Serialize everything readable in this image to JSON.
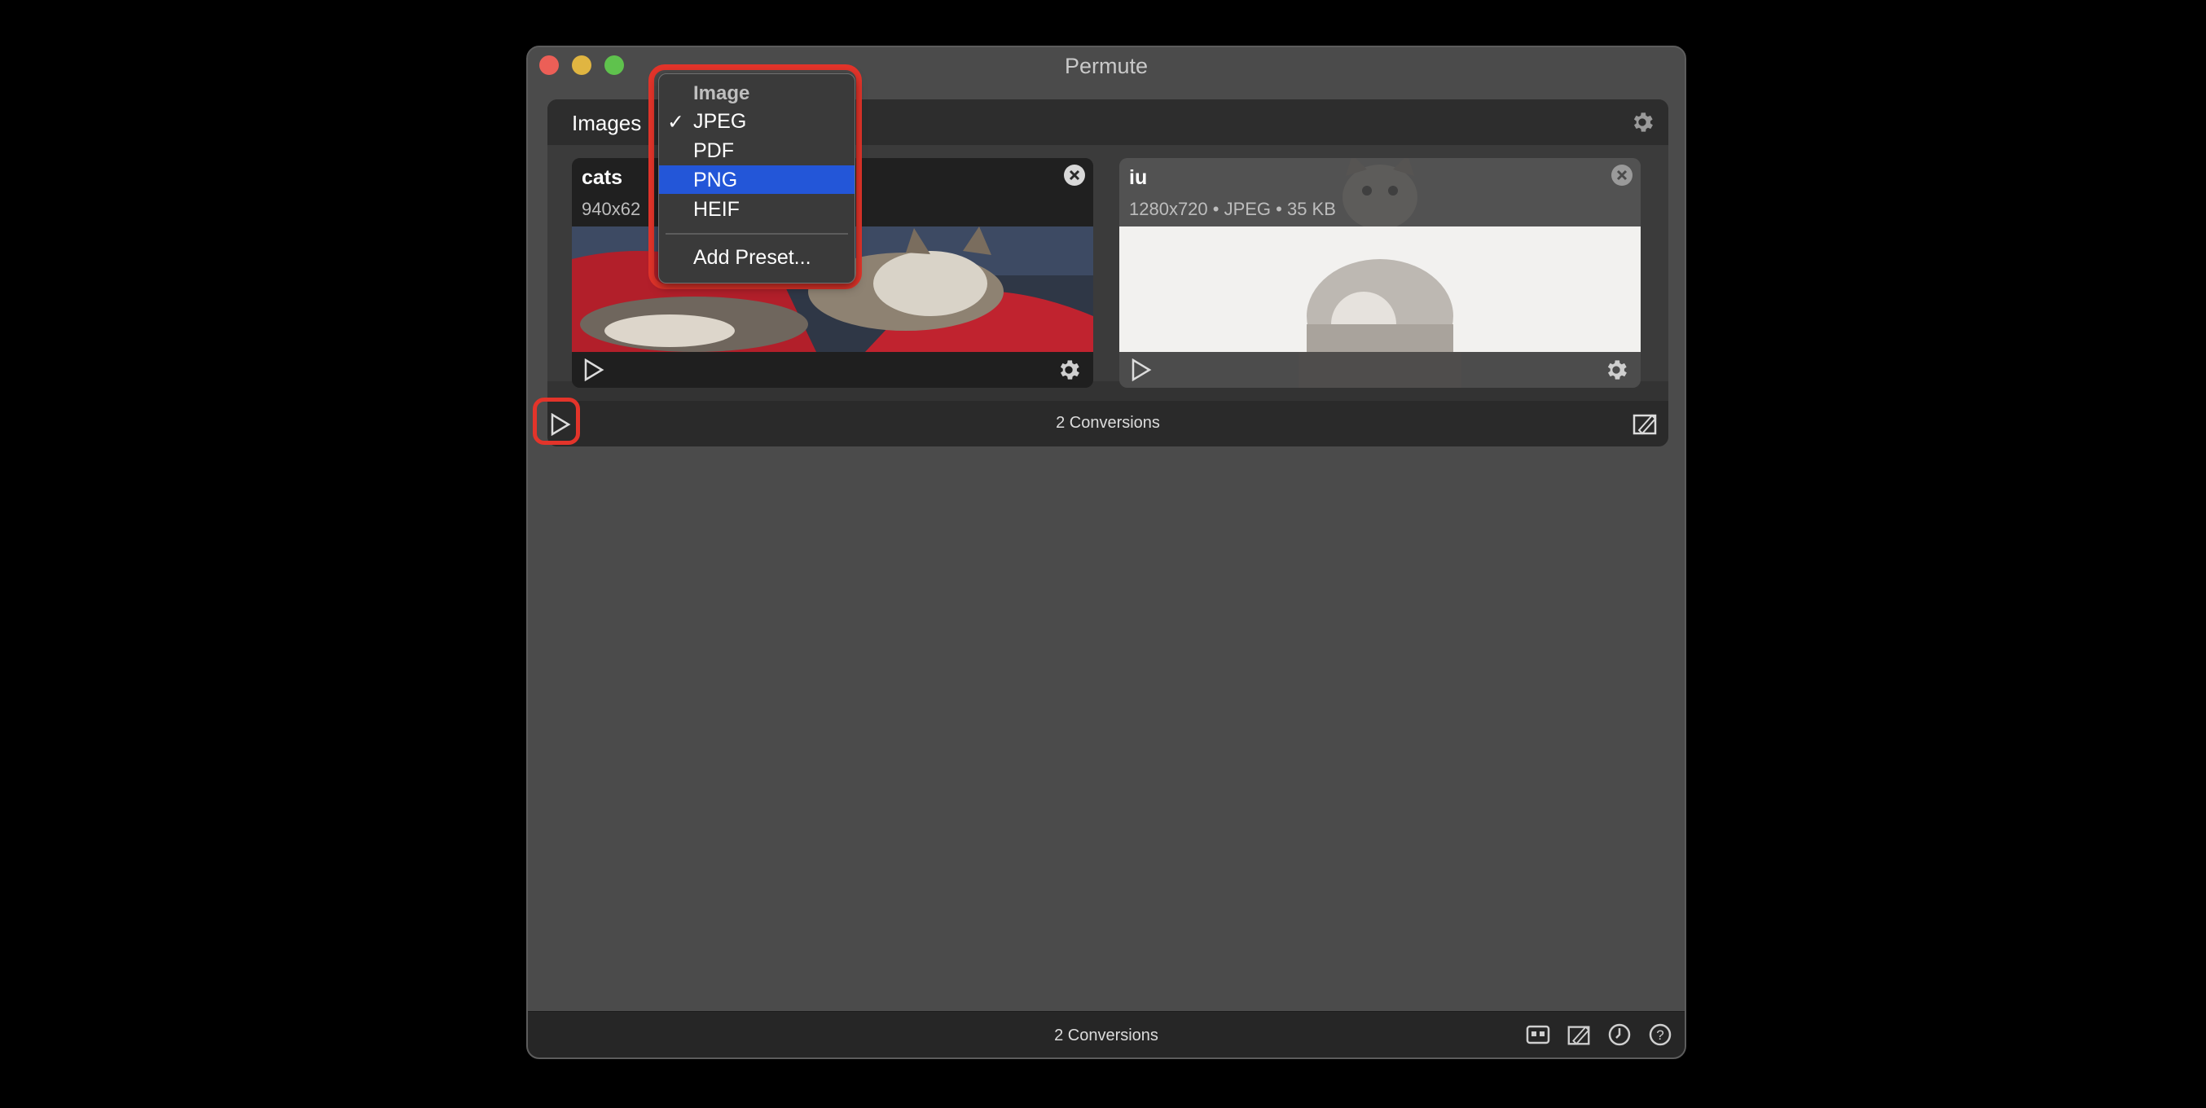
{
  "window": {
    "title": "Permute"
  },
  "group": {
    "name": "Images",
    "footer_count": "2 Conversions"
  },
  "cards": [
    {
      "title": "cats",
      "subtitle": "940x62"
    },
    {
      "title": "iu",
      "subtitle": "1280x720 • JPEG • 35 KB"
    }
  ],
  "menu": {
    "header": "Image",
    "checkmark": "✓",
    "items": [
      "JPEG",
      "PDF",
      "PNG",
      "HEIF"
    ],
    "checked": "JPEG",
    "highlighted": "PNG",
    "add_preset": "Add Preset..."
  },
  "status": {
    "count": "2 Conversions"
  },
  "colors": {
    "highlight": "#2356d8",
    "annotation": "#e3342a"
  }
}
